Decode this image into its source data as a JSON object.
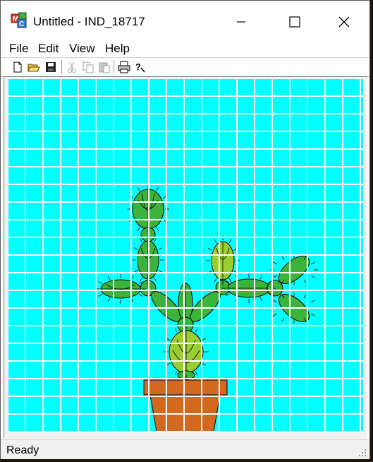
{
  "window": {
    "title": "Untitled - IND_18717",
    "controls": [
      "minimize",
      "maximize",
      "close"
    ]
  },
  "menu": {
    "items": [
      "File",
      "Edit",
      "View",
      "Help"
    ]
  },
  "toolbar": {
    "buttons": [
      "new-file-icon",
      "open-folder-icon",
      "save-icon",
      "cut-icon",
      "copy-icon",
      "paste-icon",
      "print-icon",
      "help-icon"
    ]
  },
  "canvas": {
    "background_color": "#00ffff",
    "grid_color": "#ffffff",
    "grid_columns": 20,
    "grid_rows": 20,
    "pot_color": "#d2691e",
    "cactus_dark": "#3cb43c",
    "cactus_light": "#9acd32"
  },
  "status": {
    "text": "Ready"
  }
}
